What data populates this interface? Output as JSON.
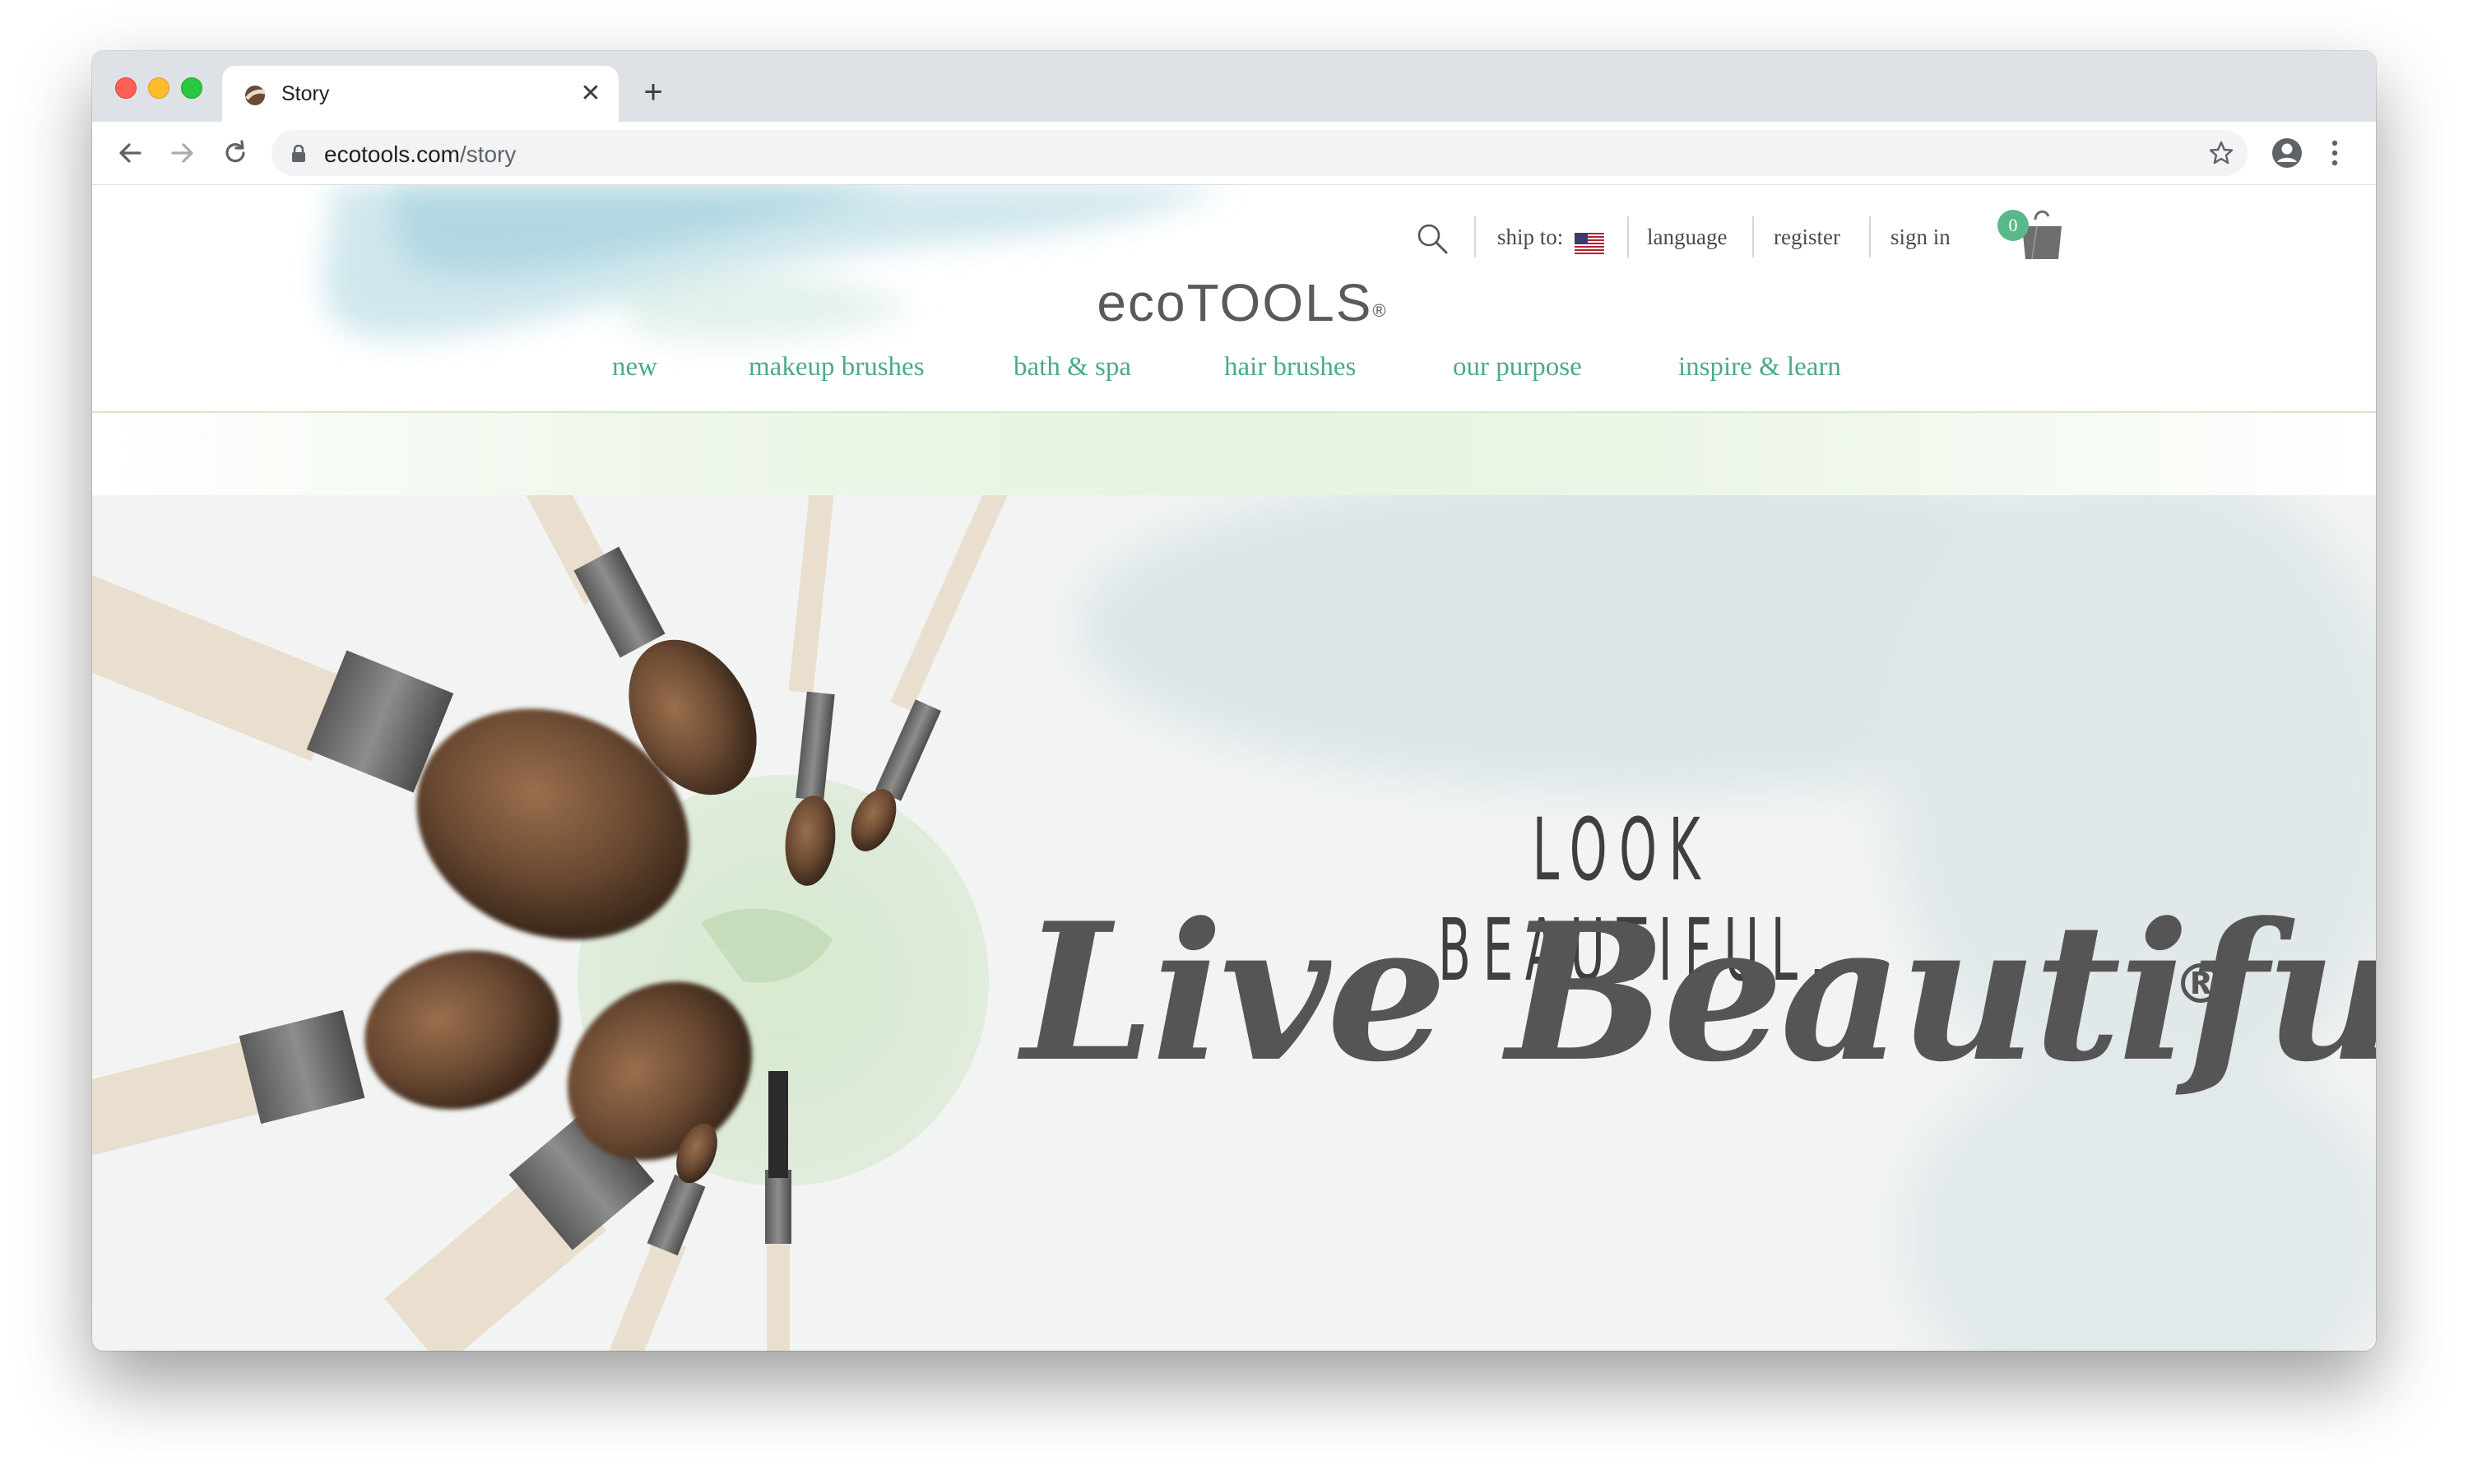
{
  "browser": {
    "tab_title": "Story",
    "close_label": "✕",
    "new_tab_label": "+",
    "url_domain": "ecotools.com",
    "url_path": "/story"
  },
  "header": {
    "utility": {
      "ship_to_label": "ship to:",
      "language_label": "language",
      "register_label": "register",
      "sign_in_label": "sign in",
      "cart_count": "0"
    },
    "logo_text": "ecoTOOLS",
    "logo_mark": "®",
    "nav": [
      {
        "label": "new"
      },
      {
        "label": "makeup brushes"
      },
      {
        "label": "bath & spa"
      },
      {
        "label": "hair brushes"
      },
      {
        "label": "our purpose"
      },
      {
        "label": "inspire & learn"
      }
    ]
  },
  "hero": {
    "tagline_top": "LOOK BEAUTIFUL.",
    "tagline_main": "Live Beautifully",
    "tagline_mark": "®"
  },
  "colors": {
    "nav_green": "#4bab82",
    "badge_green": "#59b98a",
    "logo_gray": "#5a5a5a"
  },
  "icons": [
    "back-arrow-icon",
    "forward-arrow-icon",
    "reload-icon",
    "lock-icon",
    "star-icon",
    "profile-icon",
    "more-icon",
    "search-icon",
    "us-flag-icon",
    "shopping-bag-icon"
  ]
}
